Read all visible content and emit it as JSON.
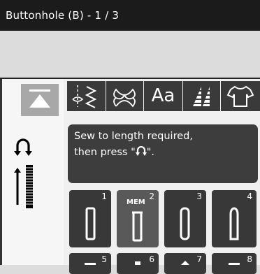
{
  "title": "Buttonhole (B) - 1 / 3",
  "left_panel": {
    "up_button_icon": "triangle-up-icon",
    "stitch_indicator_icon": "reverse-buttonhole-icon"
  },
  "tabs": [
    {
      "name": "utility-stitches",
      "icon": "utility-stitch-icon"
    },
    {
      "name": "decorative-stitches",
      "icon": "decorative-stitch-icon"
    },
    {
      "name": "alphabets",
      "label": "Aa"
    },
    {
      "name": "quilt-stitches",
      "icon": "quilt-stitch-icon"
    },
    {
      "name": "garment-stitches",
      "icon": "shirt-icon"
    }
  ],
  "message": {
    "line1": "Sew to length required,",
    "line2": "then press \"",
    "line2_end": "\".",
    "inline_icon": "reverse-arrow-icon"
  },
  "stitches": [
    {
      "number": "1",
      "memo": ""
    },
    {
      "number": "2",
      "memo": "MEM"
    },
    {
      "number": "3",
      "memo": ""
    },
    {
      "number": "4",
      "memo": ""
    },
    {
      "number": "5",
      "memo": ""
    },
    {
      "number": "6",
      "memo": ""
    },
    {
      "number": "7",
      "memo": ""
    },
    {
      "number": "8",
      "memo": ""
    }
  ],
  "colors": {
    "title_bg": "#1b1b1b",
    "tab_bg": "#3a3a3a",
    "tile_bg": "#383838",
    "tile_selected_bg": "#595959",
    "message_bg": "#3d3d3d"
  }
}
